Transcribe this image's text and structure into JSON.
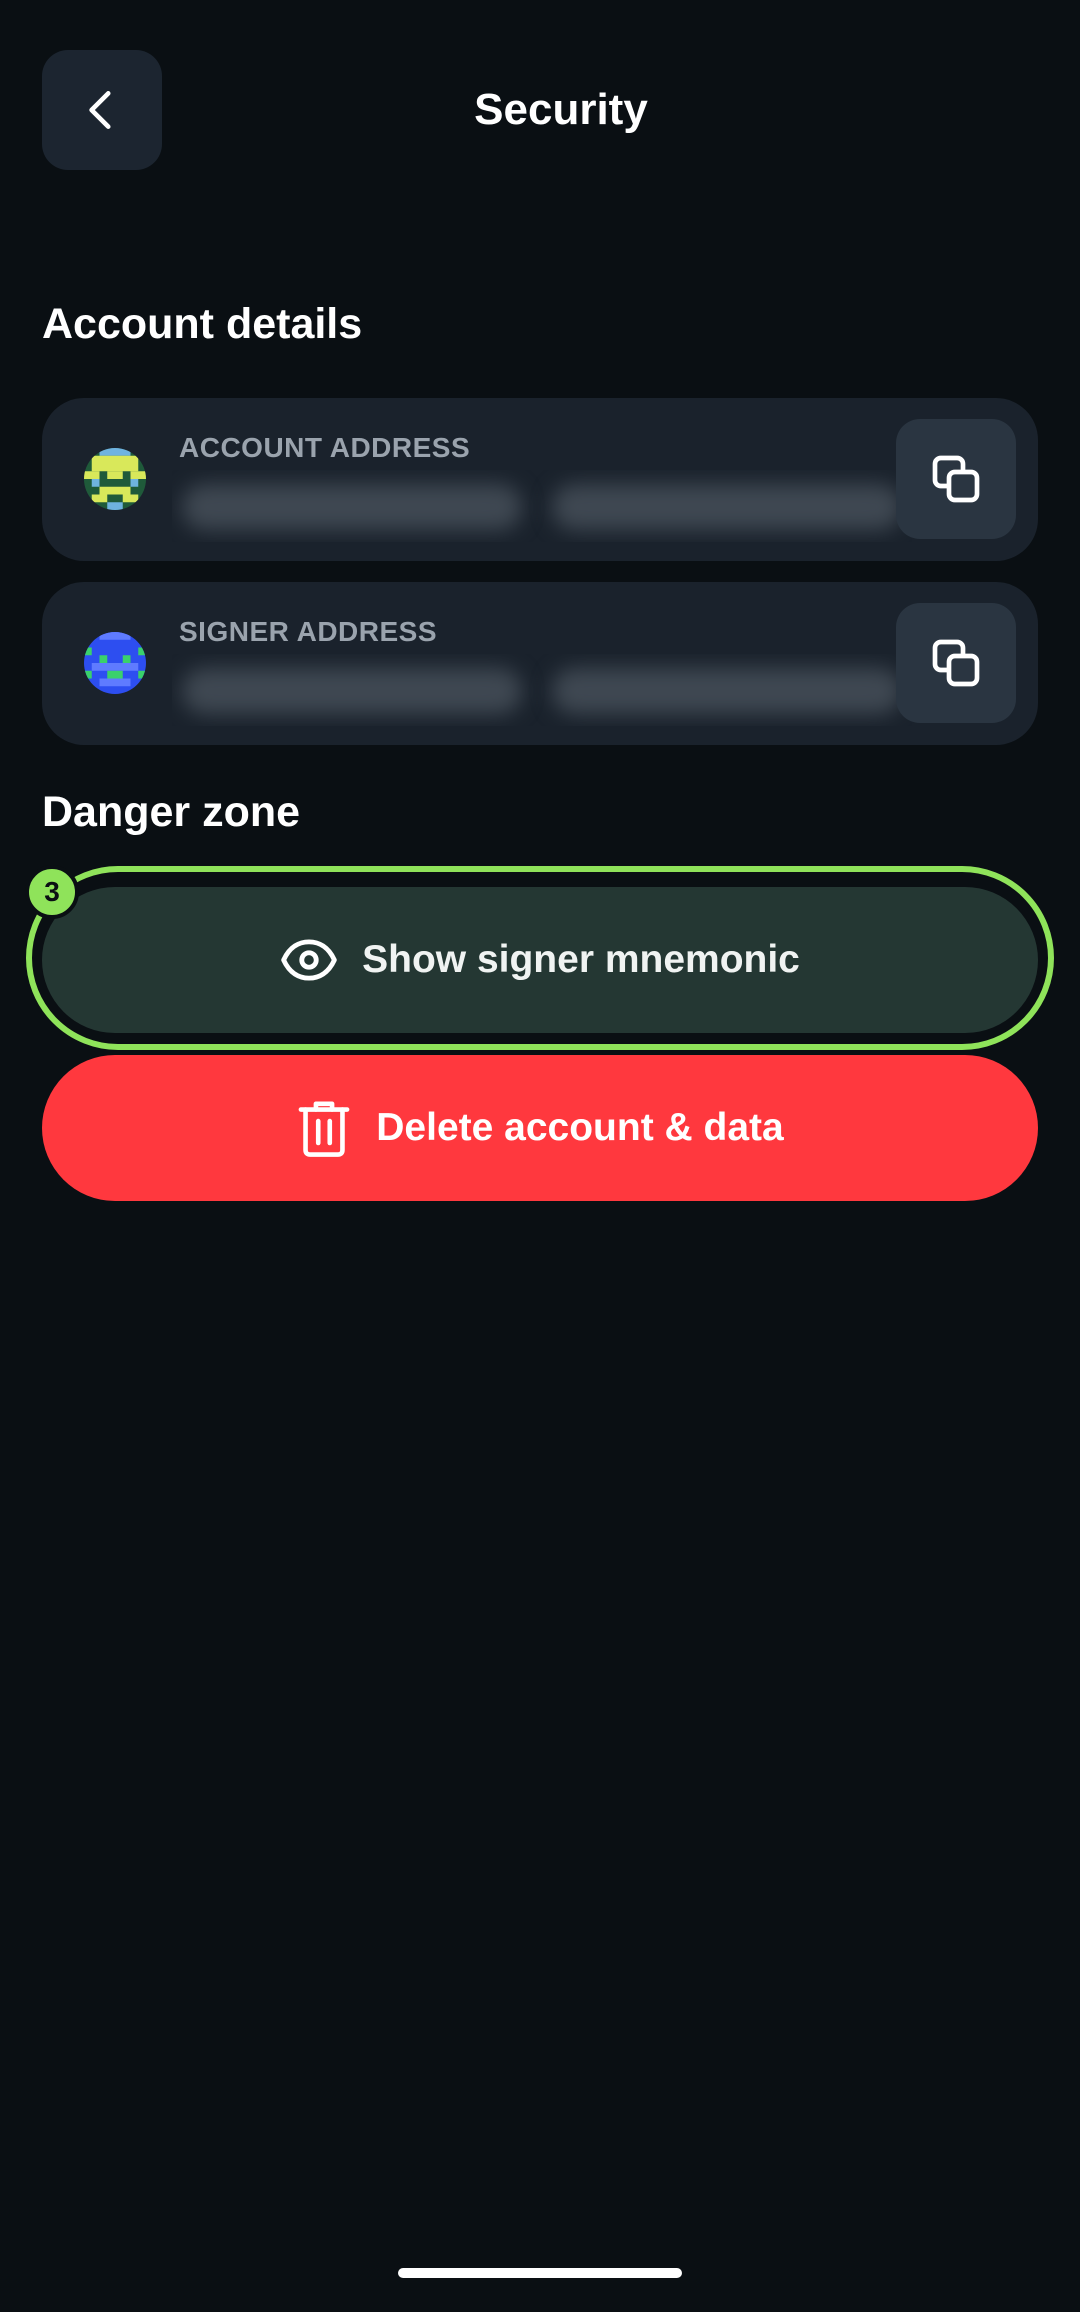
{
  "header": {
    "title": "Security",
    "back_icon": "chevron-left-icon"
  },
  "account_details": {
    "section_title": "Account details",
    "account_address": {
      "label": "ACCOUNT ADDRESS",
      "value": "",
      "value_obscured": true,
      "copy_icon": "copy-icon",
      "avatar_colors": [
        "#1f5a3a",
        "#d9e85a",
        "#6fb3e0"
      ]
    },
    "signer_address": {
      "label": "SIGNER ADDRESS",
      "value": "",
      "value_obscured": true,
      "copy_icon": "copy-icon",
      "avatar_colors": [
        "#2d4ef0",
        "#5f7bff",
        "#3ad16b"
      ]
    }
  },
  "danger_zone": {
    "section_title": "Danger zone",
    "show_mnemonic": {
      "label": "Show signer mnemonic",
      "icon": "eye-icon",
      "highlighted": true,
      "step_badge": "3"
    },
    "delete_account": {
      "label": "Delete account & data",
      "icon": "trash-icon"
    }
  },
  "colors": {
    "background": "#0a0f13",
    "card": "#1a222c",
    "highlight": "#8fe35a",
    "danger": "#ff383e",
    "mnemonic_button": "#243733"
  }
}
